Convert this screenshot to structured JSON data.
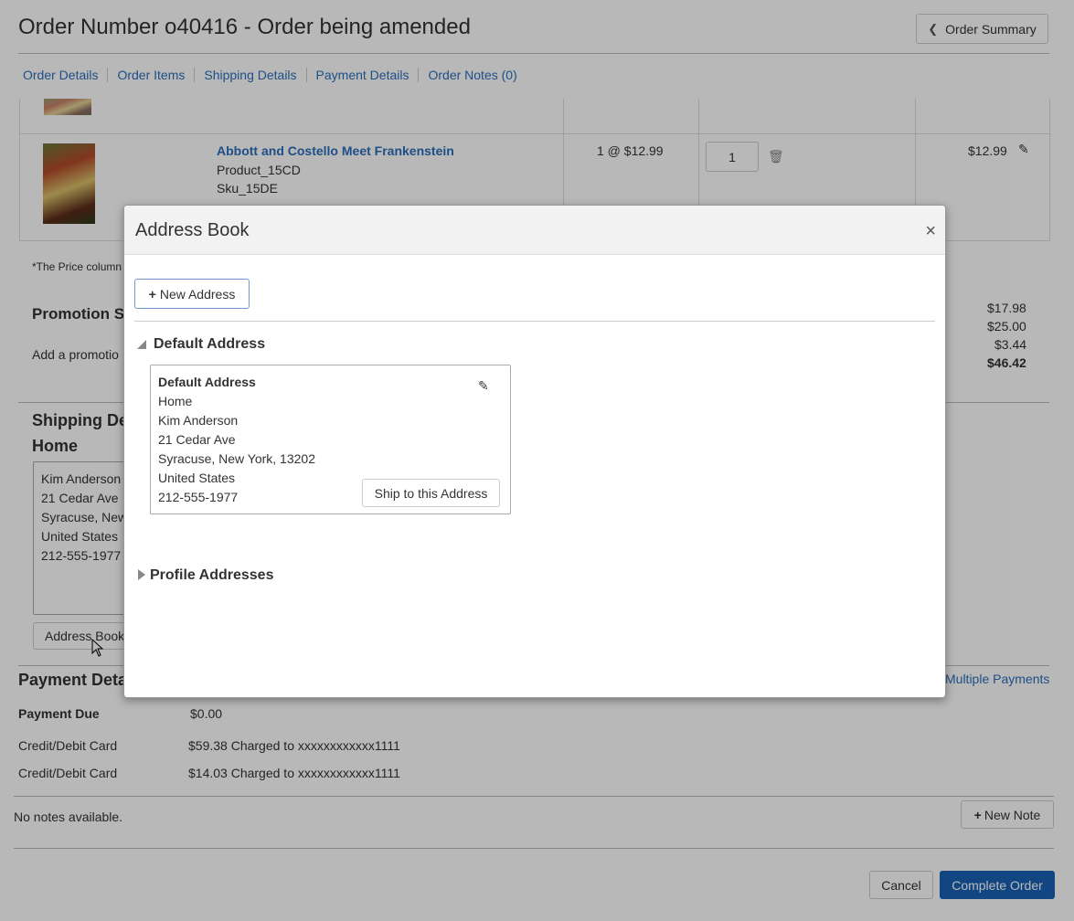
{
  "header": {
    "title": "Order Number o40416 - Order being amended",
    "order_summary_label": "Order Summary"
  },
  "tabs": [
    "Order Details",
    "Order Items",
    "Shipping Details",
    "Payment Details",
    "Order Notes (0)"
  ],
  "item": {
    "name": "Abbott and Costello Meet Frankenstein",
    "product": "Product_15CD",
    "sku": "Sku_15DE",
    "qty_price": "1 @ $12.99",
    "qty_value": "1",
    "total": "$12.99"
  },
  "price_note": "*The Price column",
  "promotion": {
    "heading": "Promotion Su",
    "add_text": "Add a promotio",
    "totals": [
      "$17.98",
      "$25.00",
      "$3.44",
      "$46.42"
    ]
  },
  "shipping": {
    "heading": "Shipping De",
    "subheading": "Home",
    "address_lines": [
      "Kim Anderson",
      "21 Cedar Ave",
      "Syracuse, New",
      "United States",
      "212-555-1977"
    ],
    "address_book_button": "Address Book"
  },
  "payment": {
    "heading": "Payment Deta",
    "multiple_payments_link": "Multiple Payments",
    "due_label": "Payment Due",
    "due_value": "$0.00",
    "rows": [
      {
        "label": "Credit/Debit Card",
        "value": "$59.38 Charged to xxxxxxxxxxxx1111"
      },
      {
        "label": "Credit/Debit Card",
        "value": "$14.03 Charged to xxxxxxxxxxxx1111"
      }
    ]
  },
  "notes": {
    "empty_text": "No notes available.",
    "new_note_button": "New Note"
  },
  "footer": {
    "cancel_label": "Cancel",
    "complete_label": "Complete Order"
  },
  "modal": {
    "title": "Address Book",
    "close_glyph": "×",
    "new_address_label": "New Address",
    "default_section": "Default Address",
    "card": {
      "title": "Default Address",
      "lines": [
        "Home",
        "Kim Anderson",
        "21 Cedar Ave",
        "Syracuse, New York, 13202",
        "United States",
        "212-555-1977"
      ],
      "ship_button": "Ship to this Address"
    },
    "profile_section": "Profile Addresses"
  },
  "colors": {
    "link": "#2a6ebb",
    "primary": "#1a62b5"
  }
}
